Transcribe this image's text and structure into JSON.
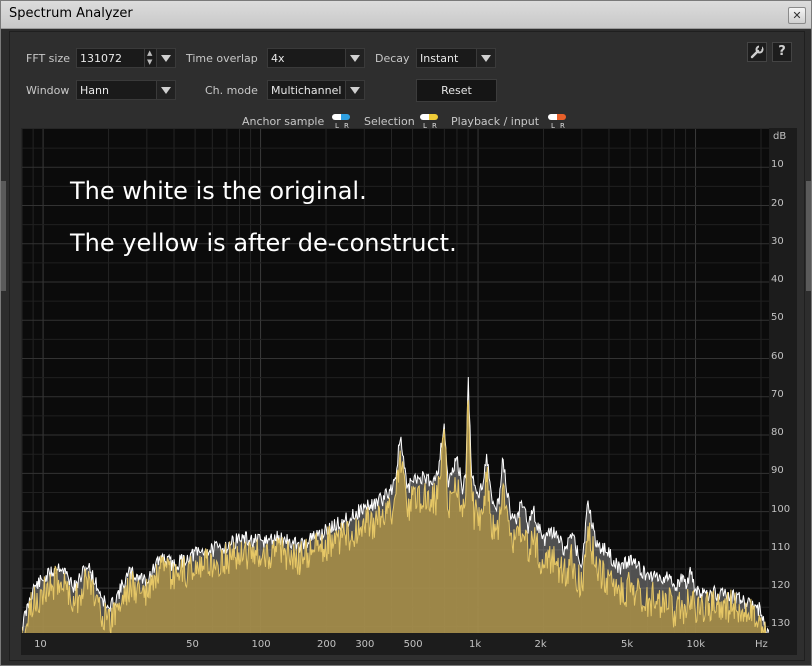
{
  "window": {
    "title": "Spectrum Analyzer",
    "close_glyph": "✕"
  },
  "controls": {
    "fft_size": {
      "label": "FFT size",
      "value": "131072"
    },
    "time_overlap": {
      "label": "Time overlap",
      "value": "4x"
    },
    "decay": {
      "label": "Decay",
      "value": "Instant"
    },
    "window": {
      "label": "Window",
      "value": "Hann"
    },
    "ch_mode": {
      "label": "Ch. mode",
      "value": "Multichannel"
    },
    "reset_label": "Reset",
    "wrench_icon": "wrench-icon",
    "help_label": "?"
  },
  "legend": {
    "anchor_sample": "Anchor sample",
    "selection": "Selection",
    "playback_input": "Playback / input",
    "L": "L",
    "R": "R",
    "colors": {
      "anchor_left": "#ffffff",
      "anchor_right": "#2f9fe0",
      "selection_left": "#ffffff",
      "selection_right": "#f0cc38",
      "playback_left": "#ffffff",
      "playback_right": "#e8602a"
    }
  },
  "annotations": {
    "line1": "The white is the original.",
    "line2": "The yellow is after de-construct."
  },
  "chart_data": {
    "type": "area",
    "x_scale": "log",
    "xlim": [
      8,
      22000
    ],
    "ylim": [
      -132,
      0
    ],
    "x_ticks": [
      {
        "v": 10,
        "label": "10"
      },
      {
        "v": 50,
        "label": "50"
      },
      {
        "v": 100,
        "label": "100"
      },
      {
        "v": 200,
        "label": "200"
      },
      {
        "v": 300,
        "label": "300"
      },
      {
        "v": 500,
        "label": "500"
      },
      {
        "v": 1000,
        "label": "1k"
      },
      {
        "v": 2000,
        "label": "2k"
      },
      {
        "v": 5000,
        "label": "5k"
      },
      {
        "v": 10000,
        "label": "10k"
      }
    ],
    "x_unit": "Hz",
    "y_unit": "dB",
    "y_ticks": [
      {
        "v": -10,
        "label": "10"
      },
      {
        "v": -20,
        "label": "20"
      },
      {
        "v": -30,
        "label": "30"
      },
      {
        "v": -40,
        "label": "40"
      },
      {
        "v": -50,
        "label": "50"
      },
      {
        "v": -60,
        "label": "60"
      },
      {
        "v": -70,
        "label": "70"
      },
      {
        "v": -80,
        "label": "80"
      },
      {
        "v": -90,
        "label": "90"
      },
      {
        "v": -100,
        "label": "100"
      },
      {
        "v": -110,
        "label": "110"
      },
      {
        "v": -120,
        "label": "120"
      },
      {
        "v": -130,
        "label": "130"
      }
    ],
    "grid": true,
    "series": [
      {
        "color": "#ffffff",
        "x": [
          8,
          9,
          12,
          14,
          16,
          20,
          25,
          30,
          35,
          40,
          50,
          60,
          70,
          80,
          100,
          120,
          150,
          200,
          250,
          300,
          360,
          400,
          420,
          440,
          470,
          500,
          550,
          600,
          650,
          700,
          730,
          760,
          800,
          850,
          880,
          900,
          930,
          960,
          1000,
          1050,
          1100,
          1150,
          1200,
          1250,
          1300,
          1400,
          1500,
          1600,
          1700,
          1800,
          2000,
          2200,
          2500,
          2700,
          3000,
          3200,
          3500,
          3800,
          4000,
          4300,
          4600,
          5000,
          5400,
          6000,
          6500,
          7000,
          7500,
          8000,
          8500,
          9000,
          9500,
          10000,
          11000,
          12000,
          14000,
          16000,
          18000,
          20000,
          22000
        ],
        "y": [
          -128,
          -118,
          -112,
          -118,
          -112,
          -124,
          -114,
          -116,
          -110,
          -112,
          -109,
          -108,
          -107,
          -105,
          -106,
          -105,
          -107,
          -103,
          -100,
          -97,
          -95,
          -92,
          -88,
          -78,
          -92,
          -90,
          -89,
          -90,
          -88,
          -75,
          -91,
          -88,
          -84,
          -92,
          -88,
          -62,
          -86,
          -92,
          -94,
          -90,
          -83,
          -95,
          -97,
          -95,
          -84,
          -98,
          -100,
          -95,
          -102,
          -98,
          -106,
          -103,
          -108,
          -104,
          -112,
          -96,
          -106,
          -108,
          -109,
          -112,
          -113,
          -110,
          -112,
          -115,
          -114,
          -116,
          -114,
          -118,
          -116,
          -117,
          -114,
          -119,
          -120,
          -119,
          -120,
          -121,
          -122,
          -124,
          -132
        ]
      },
      {
        "color": "#e6c766",
        "x": [
          8,
          9,
          12,
          14,
          16,
          20,
          25,
          30,
          35,
          40,
          50,
          60,
          70,
          80,
          100,
          120,
          150,
          200,
          250,
          300,
          360,
          400,
          420,
          440,
          470,
          500,
          550,
          600,
          650,
          700,
          730,
          760,
          800,
          850,
          880,
          900,
          930,
          960,
          1000,
          1050,
          1100,
          1150,
          1200,
          1250,
          1300,
          1400,
          1500,
          1600,
          1700,
          1800,
          2000,
          2200,
          2500,
          2700,
          3000,
          3200,
          3500,
          3800,
          4000,
          4300,
          4600,
          5000,
          5400,
          6000,
          6500,
          7000,
          7500,
          8000,
          8500,
          9000,
          9500,
          10000,
          11000,
          12000,
          14000,
          16000,
          18000,
          20000,
          22000
        ],
        "y": [
          -129,
          -119,
          -113,
          -119,
          -113,
          -125,
          -115,
          -117,
          -111,
          -113,
          -110,
          -109,
          -108,
          -106,
          -107,
          -106,
          -108,
          -104,
          -102,
          -99,
          -98,
          -95,
          -90,
          -80,
          -95,
          -93,
          -92,
          -93,
          -92,
          -76,
          -95,
          -92,
          -88,
          -96,
          -92,
          -63,
          -90,
          -96,
          -98,
          -94,
          -86,
          -99,
          -101,
          -99,
          -87,
          -102,
          -104,
          -99,
          -106,
          -102,
          -110,
          -107,
          -112,
          -108,
          -116,
          -99,
          -111,
          -113,
          -114,
          -116,
          -117,
          -115,
          -116,
          -119,
          -118,
          -120,
          -118,
          -122,
          -120,
          -121,
          -118,
          -122,
          -121,
          -120,
          -120,
          -121,
          -122,
          -124,
          -132
        ]
      }
    ]
  }
}
